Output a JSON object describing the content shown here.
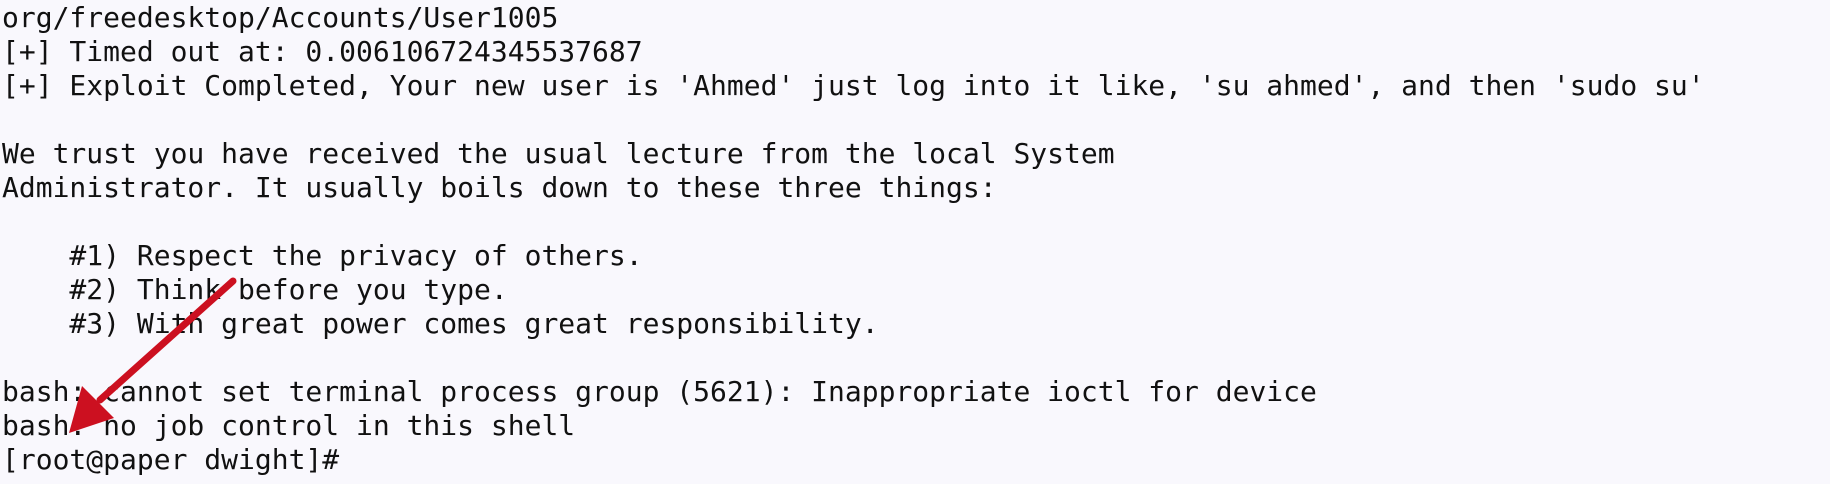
{
  "terminal": {
    "lines": [
      "org/freedesktop/Accounts/User1005",
      "[+] Timed out at: 0.006106724345537687",
      "[+] Exploit Completed, Your new user is 'Ahmed' just log into it like, 'su ahmed', and then 'sudo su'",
      "",
      "We trust you have received the usual lecture from the local System",
      "Administrator. It usually boils down to these three things:",
      "",
      "    #1) Respect the privacy of others.",
      "    #2) Think before you type.",
      "    #3) With great power comes great responsibility.",
      "",
      "bash: cannot set terminal process group (5621): Inappropriate ioctl for device",
      "bash: no job control in this shell",
      "[root@paper dwight]#"
    ]
  },
  "annotation": {
    "arrow_color": "#cc1020",
    "icon": "arrow-icon"
  }
}
